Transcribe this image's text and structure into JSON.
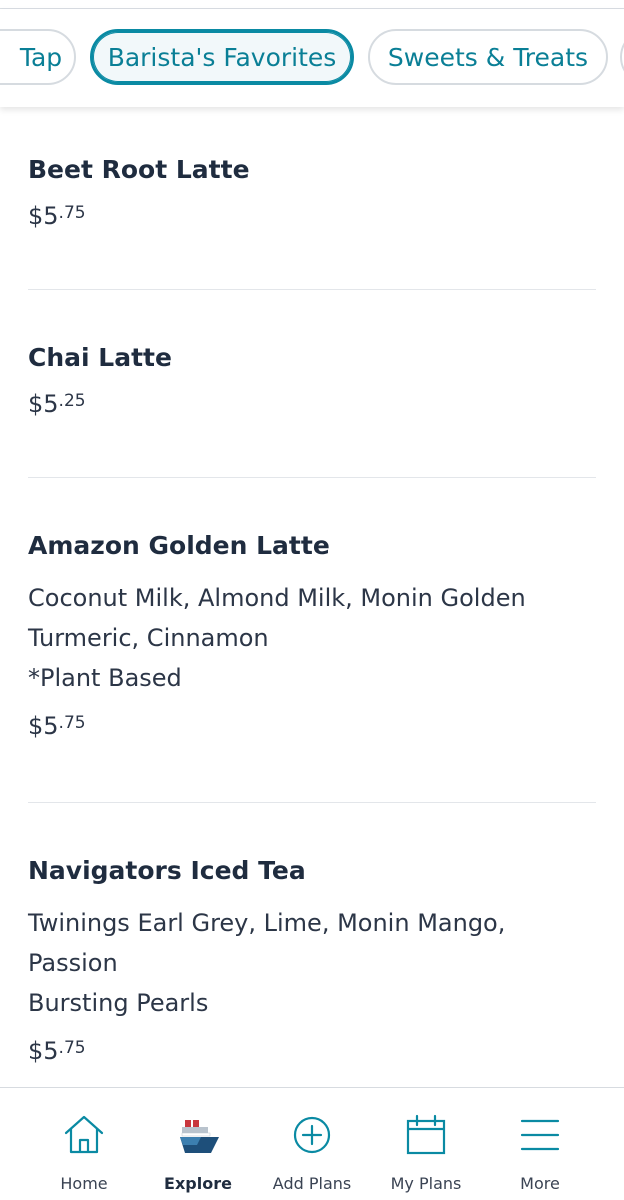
{
  "tabs": [
    {
      "label": "Tap",
      "active": false
    },
    {
      "label": "Barista's Favorites",
      "active": true
    },
    {
      "label": "Sweets & Treats",
      "active": false
    },
    {
      "label": "",
      "active": false
    }
  ],
  "menu_items": [
    {
      "title": "Beet Root Latte",
      "description": [],
      "price_dollars": "$5",
      "price_cents": ".75"
    },
    {
      "title": "Chai Latte",
      "description": [],
      "price_dollars": "$5",
      "price_cents": ".25"
    },
    {
      "title": "Amazon Golden Latte",
      "description": [
        "Coconut Milk, Almond Milk, Monin Golden",
        "Turmeric, Cinnamon",
        "*Plant Based"
      ],
      "price_dollars": "$5",
      "price_cents": ".75"
    },
    {
      "title": "Navigators Iced Tea",
      "description": [
        "Twinings Earl Grey, Lime, Monin Mango, Passion",
        "Bursting Pearls"
      ],
      "price_dollars": "$5",
      "price_cents": ".75"
    }
  ],
  "nav": [
    {
      "label": "Home",
      "icon": "home-icon",
      "active": false
    },
    {
      "label": "Explore",
      "icon": "ship-icon",
      "active": true
    },
    {
      "label": "Add Plans",
      "icon": "add-circle-icon",
      "active": false
    },
    {
      "label": "My Plans",
      "icon": "calendar-icon",
      "active": false
    },
    {
      "label": "More",
      "icon": "menu-icon",
      "active": false
    }
  ],
  "colors": {
    "accent": "#0a8aa3",
    "text": "#1f2c3f",
    "ship_red": "#c8363d",
    "ship_blue": "#1e4f7a"
  }
}
